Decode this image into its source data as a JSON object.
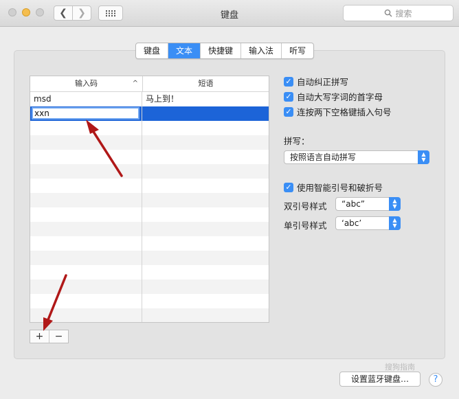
{
  "window": {
    "title": "键盘",
    "search_placeholder": "搜索"
  },
  "tabs": [
    {
      "label": "键盘",
      "active": false
    },
    {
      "label": "文本",
      "active": true
    },
    {
      "label": "快捷键",
      "active": false
    },
    {
      "label": "输入法",
      "active": false
    },
    {
      "label": "听写",
      "active": false
    }
  ],
  "table": {
    "col1_header": "输入码",
    "col2_header": "短语",
    "sort_indicator": "^",
    "rows": [
      {
        "input": "msd",
        "phrase": "马上到！"
      },
      {
        "input": "xxn",
        "phrase": ""
      }
    ]
  },
  "buttons": {
    "add": "+",
    "remove": "−",
    "bluetooth": "设置蓝牙键盘…",
    "help": "?"
  },
  "options": {
    "autocorrect": "自动纠正拼写",
    "autocap": "自动大写字词的首字母",
    "double_space": "连按两下空格键插入句号",
    "spelling_label": "拼写：",
    "spelling_value": "按照语言自动拼写",
    "smart_quotes": "使用智能引号和破折号",
    "double_quote_label": "双引号样式",
    "double_quote_value": "“abc”",
    "single_quote_label": "单引号样式",
    "single_quote_value": "‘abc’"
  },
  "watermark": "搜狗指南",
  "colors": {
    "accent": "#3a8ef5",
    "selection": "#1c64d8",
    "arrow": "#b01818"
  }
}
